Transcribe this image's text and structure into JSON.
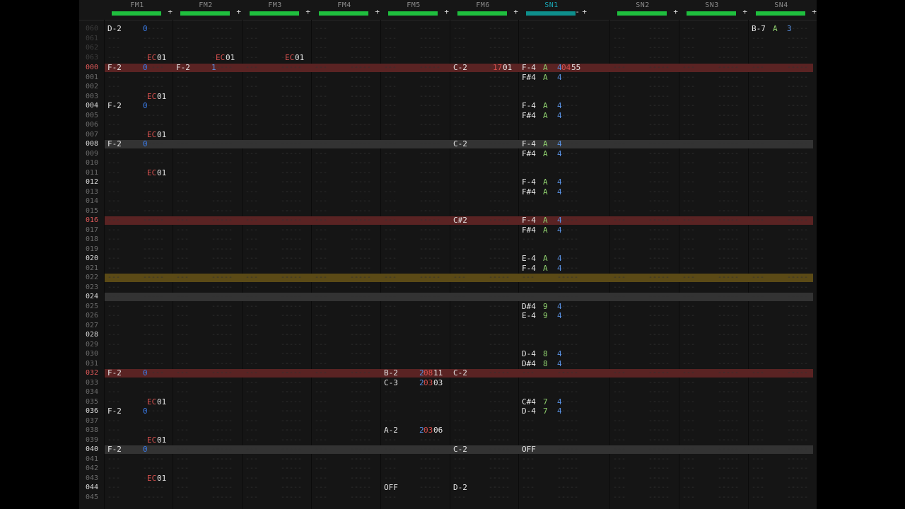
{
  "channels": [
    {
      "name": "FM1",
      "minus": false
    },
    {
      "name": "FM2",
      "minus": false
    },
    {
      "name": "FM3",
      "minus": false
    },
    {
      "name": "FM4",
      "minus": false
    },
    {
      "name": "FM5",
      "minus": false
    },
    {
      "name": "FM6",
      "minus": false
    },
    {
      "name": "SN1",
      "minus": true,
      "active": true
    },
    {
      "name": "SN2",
      "minus": false
    },
    {
      "name": "SN3",
      "minus": false
    },
    {
      "name": "SN4",
      "minus": false
    }
  ],
  "header_plus": "+",
  "header_minus": "-",
  "empty_marks": {
    "note": "---",
    "ins": "--",
    "vol": "--",
    "fx": "----"
  },
  "prev_rows": [
    "060",
    "061",
    "062",
    "063"
  ],
  "rows": [
    "000",
    "001",
    "002",
    "003",
    "004",
    "005",
    "006",
    "007",
    "008",
    "009",
    "010",
    "011",
    "012",
    "013",
    "014",
    "015",
    "016",
    "017",
    "018",
    "019",
    "020",
    "021",
    "022",
    "023",
    "024",
    "025",
    "026",
    "027",
    "028",
    "029",
    "030",
    "031",
    "032",
    "033",
    "034",
    "035",
    "036",
    "037",
    "038",
    "039",
    "040",
    "041",
    "042",
    "043",
    "044",
    "045"
  ],
  "pattern": [
    {
      "row": "060",
      "ch": 0,
      "note": "D-2",
      "vol": "0"
    },
    {
      "row": "063",
      "ch": 0,
      "fx": "EC",
      "fxv": "01"
    },
    {
      "row": "063",
      "ch": 1,
      "fx": "EC",
      "fxv": "01"
    },
    {
      "row": "063",
      "ch": 2,
      "fx": "EC",
      "fxv": "01"
    },
    {
      "row": "060",
      "ch": 9,
      "note": "B-7",
      "ins": "A",
      "vol": "3"
    },
    {
      "row": "000",
      "ch": 0,
      "note": "F-2",
      "vol": "0"
    },
    {
      "row": "000",
      "ch": 1,
      "note": "F-2",
      "vol": "1"
    },
    {
      "row": "000",
      "ch": 5,
      "note": "C-2",
      "fx": "17",
      "fxv": "01"
    },
    {
      "row": "000",
      "ch": 6,
      "note": "F-4",
      "ins": "A",
      "vol": "4",
      "fx": "04",
      "fxv": "55"
    },
    {
      "row": "001",
      "ch": 6,
      "note": "F#4",
      "ins": "A",
      "vol": "4"
    },
    {
      "row": "003",
      "ch": 0,
      "fx": "EC",
      "fxv": "01"
    },
    {
      "row": "004",
      "ch": 0,
      "note": "F-2",
      "vol": "0"
    },
    {
      "row": "004",
      "ch": 6,
      "note": "F-4",
      "ins": "A",
      "vol": "4"
    },
    {
      "row": "005",
      "ch": 6,
      "note": "F#4",
      "ins": "A",
      "vol": "4"
    },
    {
      "row": "007",
      "ch": 0,
      "fx": "EC",
      "fxv": "01"
    },
    {
      "row": "008",
      "ch": 0,
      "note": "F-2",
      "vol": "0"
    },
    {
      "row": "008",
      "ch": 5,
      "note": "C-2"
    },
    {
      "row": "008",
      "ch": 6,
      "note": "F-4",
      "ins": "A",
      "vol": "4"
    },
    {
      "row": "009",
      "ch": 6,
      "note": "F#4",
      "ins": "A",
      "vol": "4"
    },
    {
      "row": "011",
      "ch": 0,
      "fx": "EC",
      "fxv": "01"
    },
    {
      "row": "012",
      "ch": 6,
      "note": "F-4",
      "ins": "A",
      "vol": "4"
    },
    {
      "row": "013",
      "ch": 6,
      "note": "F#4",
      "ins": "A",
      "vol": "4"
    },
    {
      "row": "016",
      "ch": 5,
      "note": "C#2"
    },
    {
      "row": "016",
      "ch": 6,
      "note": "F-4",
      "ins": "A",
      "vol": "4"
    },
    {
      "row": "017",
      "ch": 6,
      "note": "F#4",
      "ins": "A",
      "vol": "4"
    },
    {
      "row": "020",
      "ch": 6,
      "note": "E-4",
      "ins": "A",
      "vol": "4"
    },
    {
      "row": "021",
      "ch": 6,
      "note": "F-4",
      "ins": "A",
      "vol": "4"
    },
    {
      "row": "025",
      "ch": 6,
      "note": "D#4",
      "ins": "9",
      "vol": "4"
    },
    {
      "row": "026",
      "ch": 6,
      "note": "E-4",
      "ins": "9",
      "vol": "4"
    },
    {
      "row": "030",
      "ch": 6,
      "note": "D-4",
      "ins": "8",
      "vol": "4"
    },
    {
      "row": "031",
      "ch": 6,
      "note": "D#4",
      "ins": "8",
      "vol": "4"
    },
    {
      "row": "032",
      "ch": 0,
      "note": "F-2",
      "vol": "0"
    },
    {
      "row": "032",
      "ch": 4,
      "note": "B-2",
      "vol": "2",
      "fx": "08",
      "fxv": "11"
    },
    {
      "row": "032",
      "ch": 5,
      "note": "C-2"
    },
    {
      "row": "033",
      "ch": 4,
      "note": "C-3",
      "vol": "2",
      "fx": "03",
      "fxv": "03"
    },
    {
      "row": "035",
      "ch": 0,
      "fx": "EC",
      "fxv": "01"
    },
    {
      "row": "035",
      "ch": 6,
      "note": "C#4",
      "ins": "7",
      "vol": "4"
    },
    {
      "row": "036",
      "ch": 0,
      "note": "F-2",
      "vol": "0"
    },
    {
      "row": "036",
      "ch": 6,
      "note": "D-4",
      "ins": "7",
      "vol": "4"
    },
    {
      "row": "038",
      "ch": 4,
      "note": "A-2",
      "vol": "2",
      "fx": "03",
      "fxv": "06"
    },
    {
      "row": "039",
      "ch": 0,
      "fx": "EC",
      "fxv": "01"
    },
    {
      "row": "040",
      "ch": 0,
      "note": "F-2",
      "vol": "0"
    },
    {
      "row": "040",
      "ch": 5,
      "note": "C-2"
    },
    {
      "row": "040",
      "ch": 6,
      "note": "OFF"
    },
    {
      "row": "043",
      "ch": 0,
      "fx": "EC",
      "fxv": "01"
    },
    {
      "row": "044",
      "ch": 4,
      "note": "OFF"
    },
    {
      "row": "044",
      "ch": 5,
      "note": "D-2"
    }
  ],
  "highlight_rows": {
    "red": [
      "000",
      "016",
      "032"
    ],
    "gray": [
      "008",
      "024",
      "040"
    ],
    "cursor": "022"
  },
  "colors": {
    "note": "#e6e6e6",
    "instrument": "#8fd06e",
    "volume": "#5a93e6",
    "effect": "#d9514f",
    "volume_bar": "#1fbf3e",
    "active_channel": "#19a7b5",
    "row_red": "#5a2323",
    "row_gray": "#333333",
    "row_cursor": "#5b4a16"
  }
}
